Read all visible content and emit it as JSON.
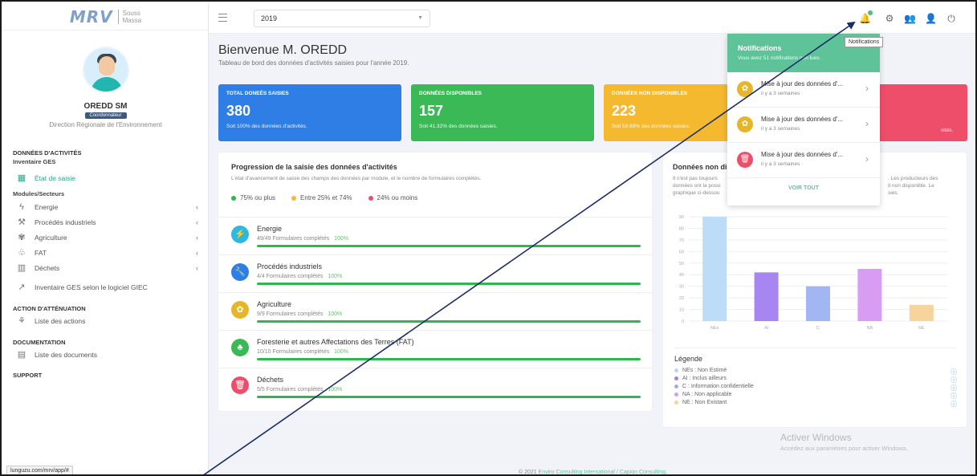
{
  "brand": {
    "name": "MRV",
    "sub1": "Souss",
    "sub2": "Massa"
  },
  "user": {
    "name": "OREDD SM",
    "role": "Coordonnateur",
    "org": "Direction Régionale de l'Environnement"
  },
  "sidebar": {
    "section_data": "DONNÉES D'ACTIVITÉS",
    "sub_inventaire": "Inventaire GES",
    "etat": "État de saisie",
    "sub_modules": "Modules/Secteurs",
    "modules": [
      {
        "label": "Energie",
        "icon": "bolt-icon"
      },
      {
        "label": "Procédés industriels",
        "icon": "wrench-icon"
      },
      {
        "label": "Agriculture",
        "icon": "wheat-icon"
      },
      {
        "label": "FAT",
        "icon": "tree-icon"
      },
      {
        "label": "Déchets",
        "icon": "trash-icon"
      }
    ],
    "inventaire_giec": "Inventaire GES selon le logiciel GIEC",
    "section_action": "ACTION D'ATTÉNUATION",
    "actions": "Liste des actions",
    "section_doc": "DOCUMENTATION",
    "documents": "Liste des documents",
    "section_support": "SUPPORT"
  },
  "status_url": "lunguzu.com/mrv/app/#",
  "topbar": {
    "year": "2019",
    "tooltip": "Notifications"
  },
  "welcome": {
    "title": "Bienvenue M. OREDD",
    "subtitle": "Tableau de bord des données d'activités saisies pour l'année 2019."
  },
  "stats": [
    {
      "label": "TOTAL DONEÉS SAISIES",
      "value": "380",
      "note": "Soit 100% des données d'activités.",
      "color": "#2f7ee6"
    },
    {
      "label": "DONNÉES DISPONIBLES",
      "value": "157",
      "note": "Soit 41.32% des données saisies.",
      "color": "#3cb957"
    },
    {
      "label": "DONNÉES NON DISPONIBLES",
      "value": "223",
      "note": "Soit 58.68% des données saisies.",
      "color": "#f5b92f"
    },
    {
      "label": "",
      "value": "",
      "note": "vités.",
      "color": "#ef4e6b"
    }
  ],
  "progress": {
    "title": "Progression de la saisie des données d'activités",
    "desc": "L'état d'avancement de saisie des champs des données par module, et le nombre de formulaires complétés.",
    "legend": [
      {
        "label": "75% ou plus",
        "color": "#2db84d"
      },
      {
        "label": "Entre 25% et 74%",
        "color": "#f5b92f"
      },
      {
        "label": "24% ou moins",
        "color": "#ef4e6b"
      }
    ],
    "modules": [
      {
        "name": "Energie",
        "sub": "49/49 Formulaires complétés",
        "pct": "100%",
        "color": "#2db8e0",
        "icon": "⚡"
      },
      {
        "name": "Procédés industriels",
        "sub": "4/4 Formulaires complétés",
        "pct": "100%",
        "color": "#2f7ee6",
        "icon": "🔧"
      },
      {
        "name": "Agriculture",
        "sub": "9/9 Formulaires complétés",
        "pct": "100%",
        "color": "#e6b52a",
        "icon": "✿"
      },
      {
        "name": "Foresterie et autres Affectations des Terres (FAT)",
        "sub": "10/10 Formulaires complétés",
        "pct": "100%",
        "color": "#3cb957",
        "icon": "♣"
      },
      {
        "name": "Déchets",
        "sub": "5/5 Formulaires complétés",
        "pct": "100%",
        "color": "#ef4e6b",
        "icon": "🗑"
      }
    ]
  },
  "nd_card": {
    "title": "Données non dis",
    "desc_left": "Il n'est pas toujours",
    "desc_left2": "données ont la possi",
    "desc_left3": "graphique ci-dessou",
    "desc_right": ". Les producteurs des",
    "desc_right2": "it non disponible. Le",
    "desc_right3": "sies.",
    "legend_title": "Légende",
    "legend": [
      {
        "label": "NEs : Non Estimé",
        "color": "#b9d6f6"
      },
      {
        "label": "AI : Inclus ailleurs",
        "color": "#a27ff0"
      },
      {
        "label": "C : Information confidentielle",
        "color": "#9aaef0"
      },
      {
        "label": "NA : Non applicable",
        "color": "#d79bf0"
      },
      {
        "label": "NE : Non Existant",
        "color": "#f6d29a"
      }
    ]
  },
  "chart_data": {
    "type": "bar",
    "categories": [
      "NEs",
      "AI",
      "C",
      "NA",
      "NE"
    ],
    "values": [
      90,
      42,
      30,
      45,
      14
    ],
    "colors": [
      "#bcdcf8",
      "#a886f2",
      "#a3b6f4",
      "#d89df2",
      "#f7d39e"
    ],
    "ylim": [
      0,
      90
    ],
    "yticks": [
      "0",
      "10",
      "20",
      "30",
      "40",
      "50",
      "60",
      "70",
      "80",
      "90"
    ]
  },
  "notifications": {
    "title": "Notifications",
    "subtitle": "Vous avez 51 notifications non lues.",
    "items": [
      {
        "title": "Mise à jour des données d'...",
        "time": "il y a 3 semaines",
        "color": "#e6b52a",
        "icon": "✿"
      },
      {
        "title": "Mise à jour des données d'...",
        "time": "il y a 3 semaines",
        "color": "#e6b52a",
        "icon": "✿"
      },
      {
        "title": "Mise à jour des données d'...",
        "time": "il y a 3 semaines",
        "color": "#ef4e6b",
        "icon": "🗑"
      }
    ],
    "view_all": "VOIR TOUT"
  },
  "footer": {
    "prefix": "© 2021",
    "link": "Enviro Consulting International / Capion Consulting",
    "suffix": "."
  },
  "watermark": {
    "line1": "Activer Windows",
    "line2": "Accédez aux paramètres pour activer Windows."
  }
}
